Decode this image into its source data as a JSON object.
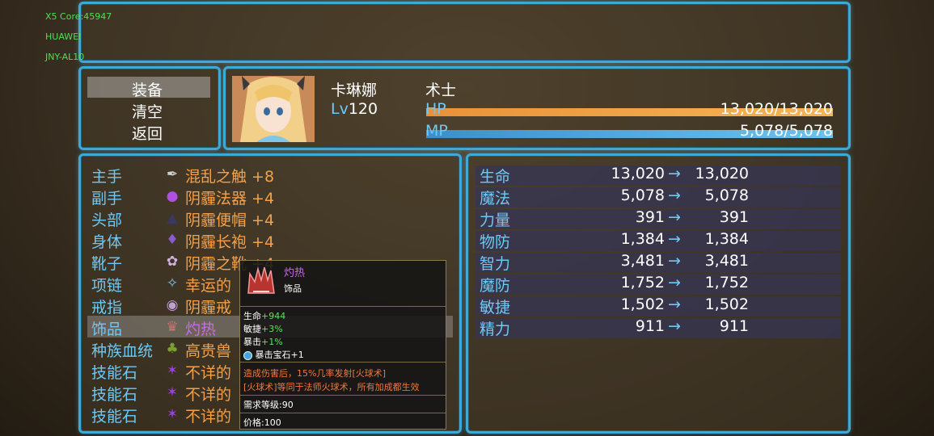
{
  "debug": [
    "X5 Core:45947",
    "HUAWEI",
    "JNY-AL10"
  ],
  "menu": {
    "items": [
      "装备",
      "清空",
      "返回"
    ],
    "selected": 0
  },
  "actor": {
    "name": "卡琳娜",
    "class": "术士",
    "level_prefix": "Lv",
    "level": "120",
    "hp_label": "HP",
    "hp_text": "13,020/13,020",
    "hp_ratio": 1.0,
    "mp_label": "MP",
    "mp_text": "5,078/5,078",
    "mp_ratio": 1.0,
    "colors": {
      "hp": "#e8923a",
      "mp": "#4aa3dc"
    }
  },
  "equipment": [
    {
      "slot": "主手",
      "icon": "wand-icon",
      "glyph": "✒",
      "item": "混乱之触 +8"
    },
    {
      "slot": "副手",
      "icon": "orb-icon",
      "glyph": "●",
      "item": "阴霾法器 +4"
    },
    {
      "slot": "头部",
      "icon": "witch-hat-icon",
      "glyph": "▲",
      "item": "阴霾便帽 +4"
    },
    {
      "slot": "身体",
      "icon": "robe-icon",
      "glyph": "♦",
      "item": "阴霾长袍 +4"
    },
    {
      "slot": "靴子",
      "icon": "boots-icon",
      "glyph": "✿",
      "item": "阴霾之靴 +4"
    },
    {
      "slot": "项链",
      "icon": "necklace-icon",
      "glyph": "✧",
      "item": "幸运的"
    },
    {
      "slot": "戒指",
      "icon": "ring-icon",
      "glyph": "◉",
      "item": "阴霾戒"
    },
    {
      "slot": "饰品",
      "icon": "crown-icon",
      "glyph": "♛",
      "item": "灼热"
    },
    {
      "slot": "种族血统",
      "icon": "bloodline-icon",
      "glyph": "♣",
      "item": "高贵兽"
    },
    {
      "slot": "技能石",
      "icon": "skill-stone-icon",
      "glyph": "✶",
      "item": "不详的"
    },
    {
      "slot": "技能石",
      "icon": "skill-stone-icon",
      "glyph": "✶",
      "item": "不详的"
    },
    {
      "slot": "技能石",
      "icon": "skill-stone-icon",
      "glyph": "✶",
      "item": "不详的"
    }
  ],
  "selected_slot": 7,
  "attributes": [
    {
      "name": "生命",
      "cur": "13,020",
      "new": "13,020"
    },
    {
      "name": "魔法",
      "cur": "5,078",
      "new": "5,078"
    },
    {
      "name": "力量",
      "cur": "391",
      "new": "391"
    },
    {
      "name": "物防",
      "cur": "1,384",
      "new": "1,384"
    },
    {
      "name": "智力",
      "cur": "3,481",
      "new": "3,481"
    },
    {
      "name": "魔防",
      "cur": "1,752",
      "new": "1,752"
    },
    {
      "name": "敏捷",
      "cur": "1,502",
      "new": "1,502"
    },
    {
      "name": "精力",
      "cur": "911",
      "new": "911"
    }
  ],
  "arrow": "→",
  "tooltip": {
    "name": "灼热",
    "type": "饰品",
    "stats": [
      {
        "label": "生命",
        "value": "+944"
      },
      {
        "label": "敏捷",
        "value": "+3%"
      },
      {
        "label": "暴击",
        "value": "+1%"
      }
    ],
    "gem": "暴击宝石+1",
    "desc1": "造成伤害后，15%几率发射[火球术]",
    "desc2": "[火球术]等同于法师火球术，所有加成都生效",
    "req": "需求等级:90",
    "price": "价格:100"
  }
}
